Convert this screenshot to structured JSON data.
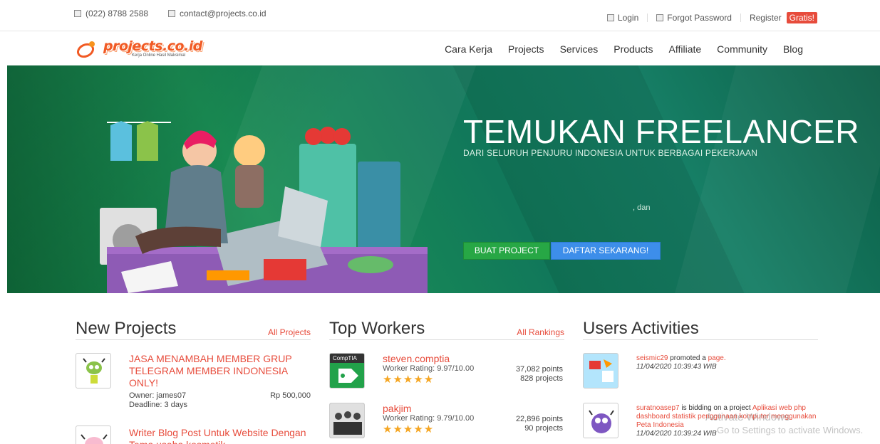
{
  "topbar": {
    "phone": "(022) 8788 2588",
    "email": "contact@projects.co.id",
    "login": "Login",
    "forgot": "Forgot Password",
    "register": "Register",
    "register_badge": "Gratis!"
  },
  "logo": {
    "wordmark": "projects.co.id",
    "tagline": "Kerja Online Hasil Maksimal"
  },
  "nav": [
    "Cara Kerja",
    "Projects",
    "Services",
    "Products",
    "Affiliate",
    "Community",
    "Blog"
  ],
  "hero": {
    "title": "TEMUKAN FREELANCER",
    "subtitle": "DARI SELURUH PENJURU INDONESIA UNTUK BERBAGAI PEKERJAAN",
    "connector": ", dan",
    "btn_create": "BUAT PROJECT",
    "btn_register": "DAFTAR SEKARANG!",
    "colors": {
      "green_btn": "#27a745",
      "blue_btn": "#3d8eea"
    }
  },
  "new_projects": {
    "title": "New Projects",
    "link": "All Projects",
    "items": [
      {
        "title": "JASA MENAMBAH MEMBER GRUP TELEGRAM MEMBER INDONESIA ONLY!",
        "owner": "Owner: james07",
        "deadline": "Deadline: 3 days",
        "budget": "Rp 500,000"
      },
      {
        "title": "Writer Blog Post Untuk Website Dengan Tema usaha kosmetik"
      }
    ]
  },
  "top_workers": {
    "title": "Top Workers",
    "link": "All Rankings",
    "items": [
      {
        "name": "steven.comptia",
        "rating": "Worker Rating: 9.97/10.00",
        "stars": "★★★★★",
        "points": "37,082 points",
        "projects": "828 projects",
        "thumb_label": "CompTIA"
      },
      {
        "name": "pakjim",
        "rating": "Worker Rating: 9.79/10.00",
        "stars": "★★★★★",
        "points": "22,896 points",
        "projects": "90 projects"
      }
    ]
  },
  "users_activities": {
    "title": "Users Activities",
    "items": [
      {
        "user": "seismic29",
        "action": " promoted a ",
        "target": "page.",
        "time": "11/04/2020 10:39:43 WIB"
      },
      {
        "user": "suratnoasep7",
        "action": " is bidding on a project ",
        "target": "Aplikasi web php dashboard statistik penggunaan komputer menggunakan Peta Indonesia",
        "time": "11/04/2020 10:39:24 WIB"
      }
    ]
  },
  "watermark": {
    "line1": "Activate Windows",
    "line2": "Go to Settings to activate Windows."
  }
}
